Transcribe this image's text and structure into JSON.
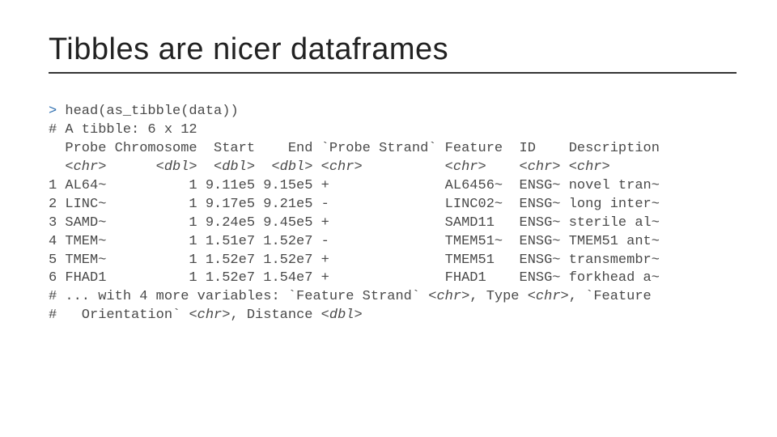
{
  "title": "Tibbles are nicer dataframes",
  "console": {
    "prompt": ">",
    "command": "head(as_tibble(data))",
    "header_hash": "#",
    "tibble_dim": "A tibble: 6 x 12",
    "col_header_line": "  Probe Chromosome  Start    End `Probe Strand` Feature  ID    Description",
    "type_line": "  <chr>      <dbl>  <dbl>  <dbl> <chr>          <chr>    <chr> <chr>",
    "rows": [
      "1 AL64~          1 9.11e5 9.15e5 +              AL6456~  ENSG~ novel tran~",
      "2 LINC~          1 9.17e5 9.21e5 -              LINC02~  ENSG~ long inter~",
      "3 SAMD~          1 9.24e5 9.45e5 +              SAMD11   ENSG~ sterile al~",
      "4 TMEM~          1 1.51e7 1.52e7 -              TMEM51~  ENSG~ TMEM51 ant~",
      "5 TMEM~          1 1.52e7 1.52e7 +              TMEM51   ENSG~ transmembr~",
      "6 FHAD1          1 1.52e7 1.54e7 +              FHAD1    ENSG~ forkhead a~"
    ],
    "trail1_prefix": "# ... with 4 more variables: `Feature Strand` ",
    "trail1_t1": "<chr>",
    "trail1_mid": ", Type ",
    "trail1_t2": "<chr>",
    "trail1_suffix": ", `Feature",
    "trail2_prefix": "#   Orientation` ",
    "trail2_t1": "<chr>",
    "trail2_mid": ", Distance ",
    "trail2_t2": "<dbl>"
  },
  "chart_data": {
    "type": "table",
    "title": "A tibble: 6 x 12",
    "columns": [
      "Probe",
      "Chromosome",
      "Start",
      "End",
      "Probe Strand",
      "Feature",
      "ID",
      "Description"
    ],
    "column_types": [
      "<chr>",
      "<dbl>",
      "<dbl>",
      "<dbl>",
      "<chr>",
      "<chr>",
      "<chr>",
      "<chr>"
    ],
    "rows": [
      {
        "Probe": "AL64~",
        "Chromosome": 1,
        "Start": "9.11e5",
        "End": "9.15e5",
        "Probe Strand": "+",
        "Feature": "AL6456~",
        "ID": "ENSG~",
        "Description": "novel tran~"
      },
      {
        "Probe": "LINC~",
        "Chromosome": 1,
        "Start": "9.17e5",
        "End": "9.21e5",
        "Probe Strand": "-",
        "Feature": "LINC02~",
        "ID": "ENSG~",
        "Description": "long inter~"
      },
      {
        "Probe": "SAMD~",
        "Chromosome": 1,
        "Start": "9.24e5",
        "End": "9.45e5",
        "Probe Strand": "+",
        "Feature": "SAMD11",
        "ID": "ENSG~",
        "Description": "sterile al~"
      },
      {
        "Probe": "TMEM~",
        "Chromosome": 1,
        "Start": "1.51e7",
        "End": "1.52e7",
        "Probe Strand": "-",
        "Feature": "TMEM51~",
        "ID": "ENSG~",
        "Description": "TMEM51 ant~"
      },
      {
        "Probe": "TMEM~",
        "Chromosome": 1,
        "Start": "1.52e7",
        "End": "1.52e7",
        "Probe Strand": "+",
        "Feature": "TMEM51",
        "ID": "ENSG~",
        "Description": "transmembr~"
      },
      {
        "Probe": "FHAD1",
        "Chromosome": 1,
        "Start": "1.52e7",
        "End": "1.54e7",
        "Probe Strand": "+",
        "Feature": "FHAD1",
        "ID": "ENSG~",
        "Description": "forkhead a~"
      }
    ],
    "omitted_variables": [
      "Feature Strand <chr>",
      "Type <chr>",
      "Feature Orientation <chr>",
      "Distance <dbl>"
    ]
  }
}
